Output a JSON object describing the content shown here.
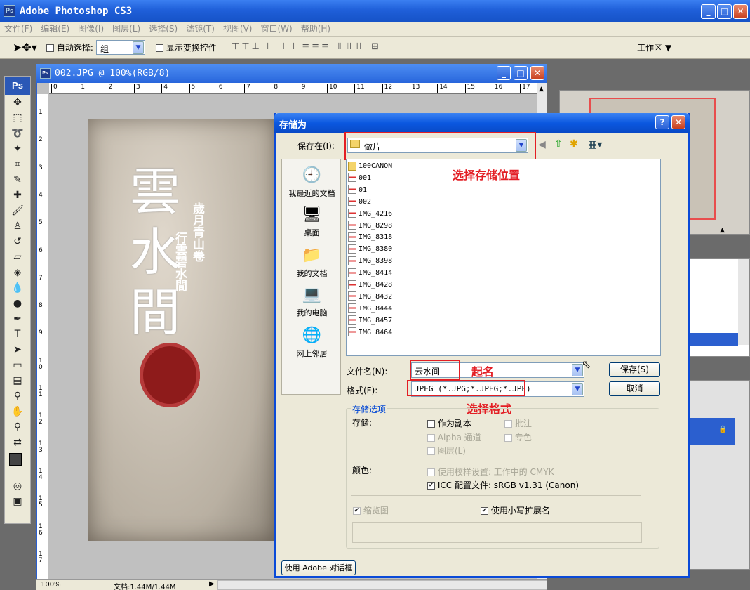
{
  "app": {
    "title": "Adobe Photoshop CS3",
    "icon": "Ps"
  },
  "menu": [
    "文件(F)",
    "编辑(E)",
    "图像(I)",
    "图层(L)",
    "选择(S)",
    "滤镜(T)",
    "视图(V)",
    "窗口(W)",
    "帮助(H)"
  ],
  "options": {
    "auto_select": "自动选择:",
    "auto_select_value": "组",
    "show_transform": "显示变换控件",
    "workspace": "工作区 ▼"
  },
  "document": {
    "title": "002.JPG @ 100%(RGB/8)",
    "zoom": "100%",
    "doc_size": "文档:1.44M/1.44M",
    "ruler_h": [
      "0",
      "1",
      "2",
      "3",
      "4",
      "5",
      "6",
      "7",
      "8",
      "9",
      "10",
      "11",
      "12",
      "13",
      "14",
      "15",
      "16",
      "17"
    ],
    "ruler_v": [
      "1",
      "2",
      "3",
      "4",
      "5",
      "6",
      "7",
      "8",
      "9",
      "1\n0",
      "1\n1",
      "1\n2",
      "1\n3",
      "1\n4",
      "1\n5",
      "1\n6",
      "1\n7"
    ],
    "artwork_text": {
      "cols": [
        "歲月青山卷",
        "行雲碧水間"
      ]
    }
  },
  "dialog": {
    "title": "存储为",
    "save_in_label": "保存在(I):",
    "save_in_value": "做片",
    "places": [
      "我最近的文档",
      "桌面",
      "我的文档",
      "我的电脑",
      "网上邻居"
    ],
    "files": [
      {
        "name": "100CANON",
        "type": "folder"
      },
      {
        "name": "001",
        "type": "jpg"
      },
      {
        "name": "01",
        "type": "jpg"
      },
      {
        "name": "002",
        "type": "jpg"
      },
      {
        "name": "IMG_4216",
        "type": "jpg"
      },
      {
        "name": "IMG_8298",
        "type": "jpg"
      },
      {
        "name": "IMG_8318",
        "type": "jpg"
      },
      {
        "name": "IMG_8380",
        "type": "jpg"
      },
      {
        "name": "IMG_8398",
        "type": "jpg"
      },
      {
        "name": "IMG_8414",
        "type": "jpg"
      },
      {
        "name": "IMG_8428",
        "type": "jpg"
      },
      {
        "name": "IMG_8432",
        "type": "jpg"
      },
      {
        "name": "IMG_8444",
        "type": "jpg"
      },
      {
        "name": "IMG_8457",
        "type": "jpg"
      },
      {
        "name": "IMG_8464",
        "type": "jpg"
      }
    ],
    "filename_label": "文件名(N):",
    "filename_value": "云水间",
    "format_label": "格式(F):",
    "format_value": "JPEG (*.JPG;*.JPEG;*.JPE)",
    "save_button": "保存(S)",
    "cancel_button": "取消",
    "options_title": "存储选项",
    "store_label": "存储:",
    "as_copy": "作为副本",
    "annotations": "批注",
    "alpha": "Alpha 通道",
    "spot": "专色",
    "layers": "图层(L)",
    "color_label": "颜色:",
    "proof": "使用校样设置: 工作中的 CMYK",
    "icc": "ICC 配置文件: sRGB v1.31 (Canon)",
    "thumbnail": "缩览图",
    "lowercase": "使用小写扩展名",
    "adobe_dialog": "使用 Adobe 对话框"
  },
  "annotations": {
    "location": "选择存储位置",
    "name": "起名",
    "format": "选择格式"
  },
  "colors": {
    "accent_red": "#e31e24",
    "xp_blue": "#0a4ad8"
  }
}
